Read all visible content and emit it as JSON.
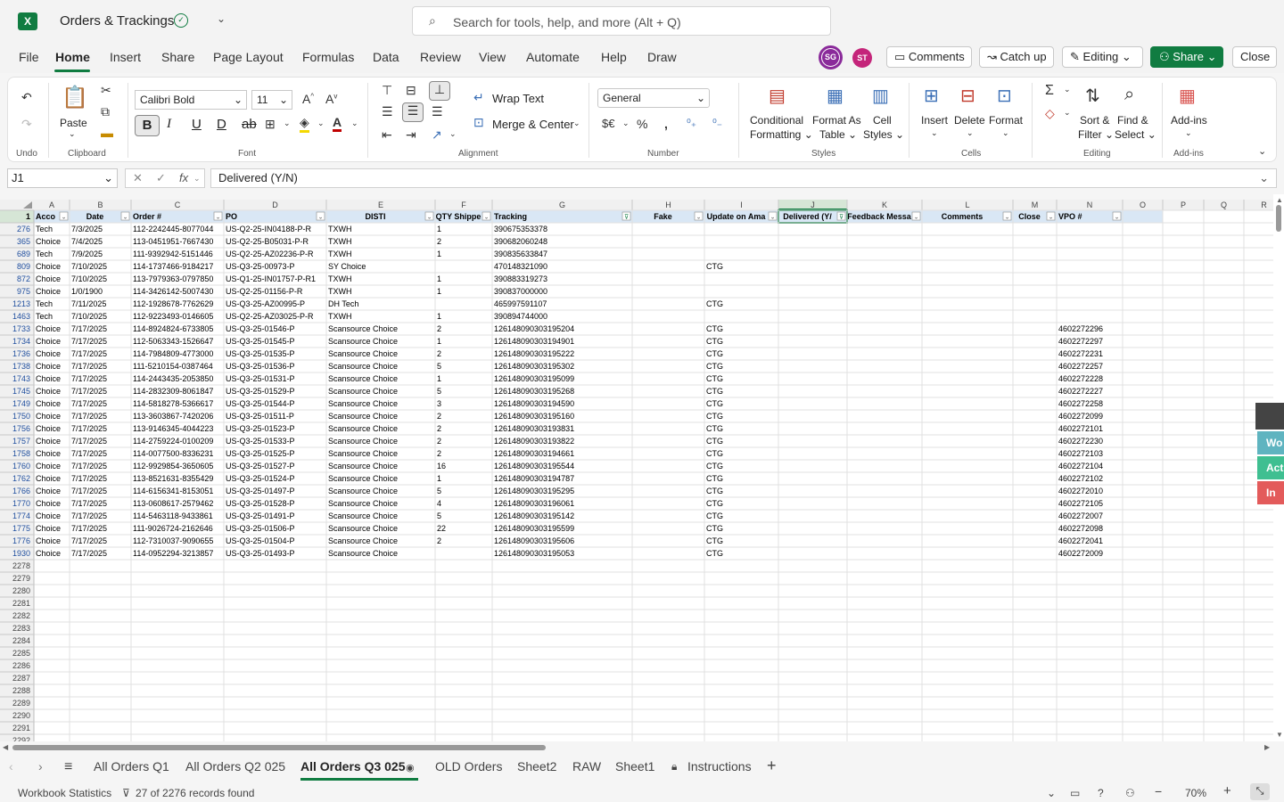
{
  "app": {
    "title": "Orders & Trackings",
    "search_placeholder": "Search for tools, help, and more (Alt + Q)"
  },
  "menu": [
    "File",
    "Home",
    "Insert",
    "Share",
    "Page Layout",
    "Formulas",
    "Data",
    "Review",
    "View",
    "Automate",
    "Help",
    "Draw"
  ],
  "menu_active": "Home",
  "users": [
    {
      "initials": "SG",
      "color": "#8a2a9a"
    },
    {
      "initials": "ST",
      "color": "#c4257a"
    }
  ],
  "top_buttons": {
    "comments": "Comments",
    "catchup": "Catch up",
    "editing": "Editing",
    "share": "Share",
    "close": "Close"
  },
  "ribbon": {
    "undo_label": "Undo",
    "paste": "Paste",
    "clipboard": "Clipboard",
    "font_name": "Calibri Bold",
    "font_size": "11",
    "font": "Font",
    "wrap_text": "Wrap Text",
    "merge_center": "Merge & Center",
    "alignment": "Alignment",
    "number_format": "General",
    "number": "Number",
    "conditional_1": "Conditional",
    "conditional_2": "Formatting",
    "format_table_1": "Format As",
    "format_table_2": "Table",
    "cell_styles_1": "Cell",
    "cell_styles_2": "Styles",
    "styles": "Styles",
    "insert": "Insert",
    "delete": "Delete",
    "format": "Format",
    "cells": "Cells",
    "sort_1": "Sort &",
    "sort_2": "Filter",
    "find_1": "Find &",
    "find_2": "Select",
    "editing": "Editing",
    "addins": "Add-ins",
    "addins_group": "Add-ins"
  },
  "formula": {
    "name_box": "J1",
    "content": "Delivered (Y/N)"
  },
  "columns": [
    "A",
    "B",
    "C",
    "D",
    "E",
    "F",
    "G",
    "H",
    "I",
    "J",
    "K",
    "L",
    "M",
    "N",
    "O",
    "P",
    "Q",
    "R"
  ],
  "header_row": {
    "row_num": "1",
    "cells": [
      "Acco",
      "Date",
      "Order #",
      "PO",
      "DISTI",
      "QTY Shippe",
      "Tracking",
      "Fake",
      "Update on Ama",
      "Delivered (Y/",
      "Feedback Messa",
      "Comments",
      "Close",
      "VPO #",
      "",
      "",
      "",
      ""
    ]
  },
  "rows": [
    {
      "n": "276",
      "c": [
        "Tech",
        "7/3/2025",
        "112-2242445-8077044",
        "US-Q2-25-IN04188-P-R",
        "TXWH",
        "1",
        "390675353378",
        "",
        "",
        "",
        "",
        "",
        "",
        ""
      ]
    },
    {
      "n": "365",
      "c": [
        "Choice",
        "7/4/2025",
        "113-0451951-7667430",
        "US-Q2-25-B05031-P-R",
        "TXWH",
        "2",
        "390682060248",
        "",
        "",
        "",
        "",
        "",
        "",
        ""
      ]
    },
    {
      "n": "689",
      "c": [
        "Tech",
        "7/9/2025",
        "111-9392942-5151446",
        "US-Q2-25-AZ02236-P-R",
        "TXWH",
        "1",
        "390835633847",
        "",
        "",
        "",
        "",
        "",
        "",
        ""
      ]
    },
    {
      "n": "809",
      "c": [
        "Choice",
        "7/10/2025",
        "114-1737466-9184217",
        "US-Q3-25-00973-P",
        "SY Choice",
        "",
        "470148321090",
        "",
        "CTG",
        "",
        "",
        "",
        "",
        ""
      ]
    },
    {
      "n": "872",
      "c": [
        "Choice",
        "7/10/2025",
        "113-7979363-0797850",
        "US-Q1-25-IN01757-P-R1",
        "TXWH",
        "1",
        "390883319273",
        "",
        "",
        "",
        "",
        "",
        "",
        ""
      ]
    },
    {
      "n": "975",
      "c": [
        "Choice",
        "1/0/1900",
        "114-3426142-5007430",
        "US-Q2-25-01156-P-R",
        "TXWH",
        "1",
        "390837000000",
        "",
        "",
        "",
        "",
        "",
        "",
        ""
      ]
    },
    {
      "n": "1213",
      "c": [
        "Tech",
        "7/11/2025",
        "112-1928678-7762629",
        "US-Q3-25-AZ00995-P",
        "DH Tech",
        "",
        "465997591107",
        "",
        "CTG",
        "",
        "",
        "",
        "",
        ""
      ]
    },
    {
      "n": "1463",
      "c": [
        "Tech",
        "7/10/2025",
        "112-9223493-0146605",
        "US-Q2-25-AZ03025-P-R",
        "TXWH",
        "1",
        "390894744000",
        "",
        "",
        "",
        "",
        "",
        "",
        ""
      ]
    },
    {
      "n": "1733",
      "c": [
        "Choice",
        "7/17/2025",
        "114-8924824-6733805",
        "US-Q3-25-01546-P",
        "Scansource Choice",
        "2",
        "126148090303195204",
        "",
        "CTG",
        "",
        "",
        "",
        "",
        "4602272296"
      ]
    },
    {
      "n": "1734",
      "c": [
        "Choice",
        "7/17/2025",
        "112-5063343-1526647",
        "US-Q3-25-01545-P",
        "Scansource Choice",
        "1",
        "126148090303194901",
        "",
        "CTG",
        "",
        "",
        "",
        "",
        "4602272297"
      ]
    },
    {
      "n": "1736",
      "c": [
        "Choice",
        "7/17/2025",
        "114-7984809-4773000",
        "US-Q3-25-01535-P",
        "Scansource Choice",
        "2",
        "126148090303195222",
        "",
        "CTG",
        "",
        "",
        "",
        "",
        "4602272231"
      ]
    },
    {
      "n": "1738",
      "c": [
        "Choice",
        "7/17/2025",
        "111-5210154-0387464",
        "US-Q3-25-01536-P",
        "Scansource Choice",
        "5",
        "126148090303195302",
        "",
        "CTG",
        "",
        "",
        "",
        "",
        "4602272257"
      ]
    },
    {
      "n": "1743",
      "c": [
        "Choice",
        "7/17/2025",
        "114-2443435-2053850",
        "US-Q3-25-01531-P",
        "Scansource Choice",
        "1",
        "126148090303195099",
        "",
        "CTG",
        "",
        "",
        "",
        "",
        "4602272228"
      ]
    },
    {
      "n": "1745",
      "c": [
        "Choice",
        "7/17/2025",
        "114-2832309-8061847",
        "US-Q3-25-01529-P",
        "Scansource Choice",
        "5",
        "126148090303195268",
        "",
        "CTG",
        "",
        "",
        "",
        "",
        "4602272227"
      ]
    },
    {
      "n": "1749",
      "c": [
        "Choice",
        "7/17/2025",
        "114-5818278-5366617",
        "US-Q3-25-01544-P",
        "Scansource Choice",
        "3",
        "126148090303194590",
        "",
        "CTG",
        "",
        "",
        "",
        "",
        "4602272258"
      ]
    },
    {
      "n": "1750",
      "c": [
        "Choice",
        "7/17/2025",
        "113-3603867-7420206",
        "US-Q3-25-01511-P",
        "Scansource Choice",
        "2",
        "126148090303195160",
        "",
        "CTG",
        "",
        "",
        "",
        "",
        "4602272099"
      ]
    },
    {
      "n": "1756",
      "c": [
        "Choice",
        "7/17/2025",
        "113-9146345-4044223",
        "US-Q3-25-01523-P",
        "Scansource Choice",
        "2",
        "126148090303193831",
        "",
        "CTG",
        "",
        "",
        "",
        "",
        "4602272101"
      ]
    },
    {
      "n": "1757",
      "c": [
        "Choice",
        "7/17/2025",
        "114-2759224-0100209",
        "US-Q3-25-01533-P",
        "Scansource Choice",
        "2",
        "126148090303193822",
        "",
        "CTG",
        "",
        "",
        "",
        "",
        "4602272230"
      ]
    },
    {
      "n": "1758",
      "c": [
        "Choice",
        "7/17/2025",
        "114-0077500-8336231",
        "US-Q3-25-01525-P",
        "Scansource Choice",
        "2",
        "126148090303194661",
        "",
        "CTG",
        "",
        "",
        "",
        "",
        "4602272103"
      ]
    },
    {
      "n": "1760",
      "c": [
        "Choice",
        "7/17/2025",
        "112-9929854-3650605",
        "US-Q3-25-01527-P",
        "Scansource Choice",
        "16",
        "126148090303195544",
        "",
        "CTG",
        "",
        "",
        "",
        "",
        "4602272104"
      ]
    },
    {
      "n": "1762",
      "c": [
        "Choice",
        "7/17/2025",
        "113-8521631-8355429",
        "US-Q3-25-01524-P",
        "Scansource Choice",
        "1",
        "126148090303194787",
        "",
        "CTG",
        "",
        "",
        "",
        "",
        "4602272102"
      ]
    },
    {
      "n": "1766",
      "c": [
        "Choice",
        "7/17/2025",
        "114-6156341-8153051",
        "US-Q3-25-01497-P",
        "Scansource Choice",
        "5",
        "126148090303195295",
        "",
        "CTG",
        "",
        "",
        "",
        "",
        "4602272010"
      ]
    },
    {
      "n": "1770",
      "c": [
        "Choice",
        "7/17/2025",
        "113-0608617-2579462",
        "US-Q3-25-01528-P",
        "Scansource Choice",
        "4",
        "126148090303196061",
        "",
        "CTG",
        "",
        "",
        "",
        "",
        "4602272105"
      ]
    },
    {
      "n": "1774",
      "c": [
        "Choice",
        "7/17/2025",
        "114-5463118-9433861",
        "US-Q3-25-01491-P",
        "Scansource Choice",
        "5",
        "126148090303195142",
        "",
        "CTG",
        "",
        "",
        "",
        "",
        "4602272007"
      ]
    },
    {
      "n": "1775",
      "c": [
        "Choice",
        "7/17/2025",
        "111-9026724-2162646",
        "US-Q3-25-01506-P",
        "Scansource Choice",
        "22",
        "126148090303195599",
        "",
        "CTG",
        "",
        "",
        "",
        "",
        "4602272098"
      ]
    },
    {
      "n": "1776",
      "c": [
        "Choice",
        "7/17/2025",
        "112-7310037-9090655",
        "US-Q3-25-01504-P",
        "Scansource Choice",
        "2",
        "126148090303195606",
        "",
        "CTG",
        "",
        "",
        "",
        "",
        "4602272041"
      ]
    },
    {
      "n": "1930",
      "c": [
        "Choice",
        "7/17/2025",
        "114-0952294-3213857",
        "US-Q3-25-01493-P",
        "Scansource Choice",
        "",
        "126148090303195053",
        "",
        "CTG",
        "",
        "",
        "",
        "",
        "4602272009"
      ]
    }
  ],
  "empty_rows": [
    "2278",
    "2279",
    "2280",
    "2281",
    "2282",
    "2283",
    "2284",
    "2285",
    "2286",
    "2287",
    "2288",
    "2289",
    "2290",
    "2291",
    "2292"
  ],
  "sheets": [
    "All Orders Q1",
    "All Orders Q2 025",
    "All Orders Q3 025",
    "OLD Orders",
    "Sheet2",
    "RAW",
    "Sheet1",
    "Instructions"
  ],
  "active_sheet": "All Orders Q3 025",
  "side_tabs": [
    {
      "label": "Wo",
      "color": "#5fb4c0"
    },
    {
      "label": "Act",
      "color": "#3fbf91"
    },
    {
      "label": "In A",
      "color": "#e35b5b"
    }
  ],
  "status": {
    "workbook_stats": "Workbook Statistics",
    "records": "27 of 2276 records found",
    "zoom": "70%"
  }
}
